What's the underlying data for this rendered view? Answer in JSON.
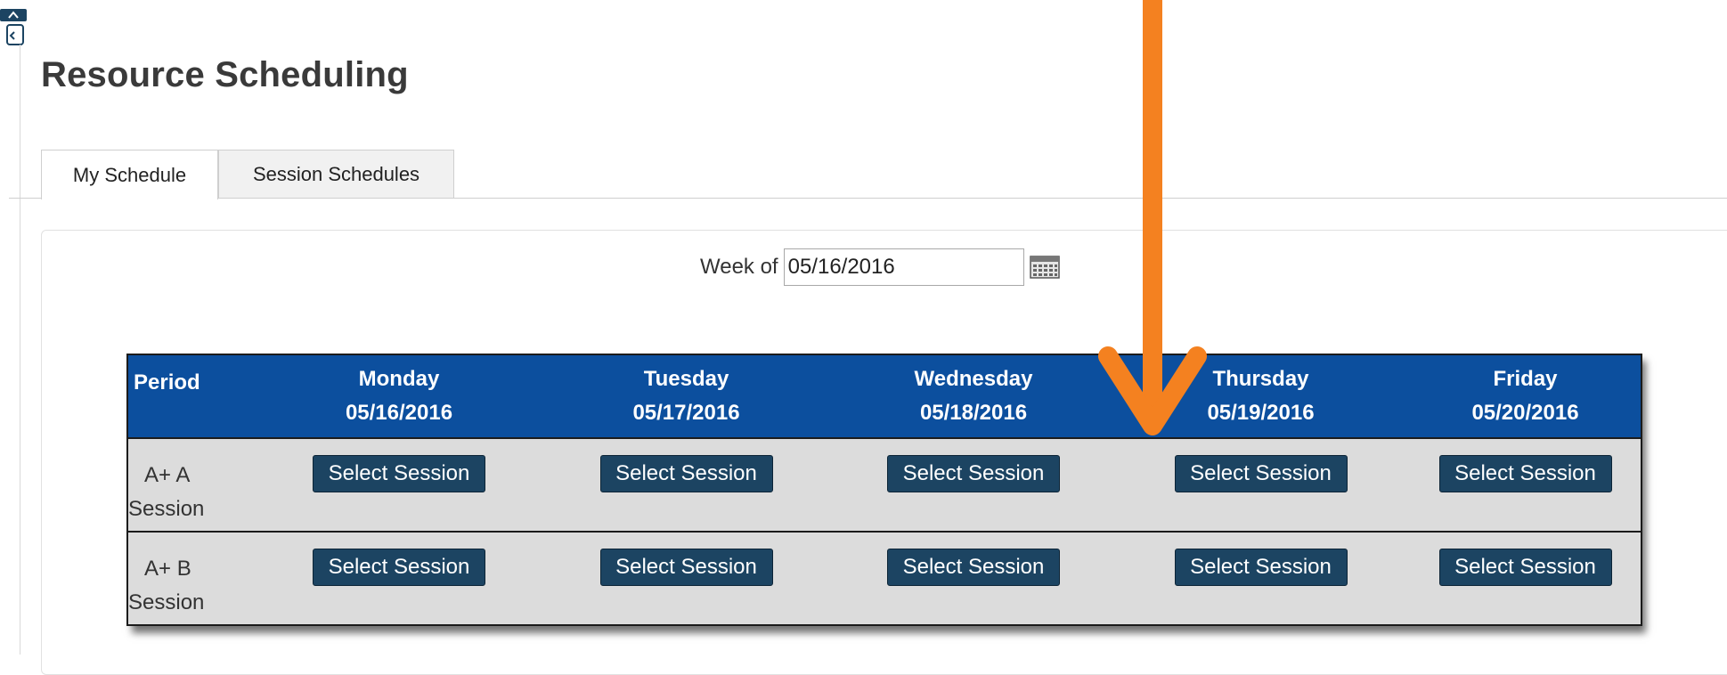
{
  "page": {
    "title": "Resource Scheduling"
  },
  "tabs": [
    {
      "label": "My Schedule",
      "active": true
    },
    {
      "label": "Session Schedules",
      "active": false
    }
  ],
  "week": {
    "label": "Week of",
    "value": "05/16/2016"
  },
  "schedule": {
    "period_header": "Period",
    "days": [
      {
        "name": "Monday",
        "date": "05/16/2016"
      },
      {
        "name": "Tuesday",
        "date": "05/17/2016"
      },
      {
        "name": "Wednesday",
        "date": "05/18/2016"
      },
      {
        "name": "Thursday",
        "date": "05/19/2016"
      },
      {
        "name": "Friday",
        "date": "05/20/2016"
      }
    ],
    "rows": [
      {
        "period_line1": "A+ A",
        "period_line2": "Session"
      },
      {
        "period_line1": "A+ B",
        "period_line2": "Session"
      }
    ],
    "button_label": "Select Session"
  },
  "colors": {
    "header_bg": "#0c4f9e",
    "button_bg": "#1c4462",
    "row_bg": "#dcdcdc",
    "annotation_arrow": "#f48120"
  },
  "icons": [
    "calendar-icon",
    "down-arrow-annotation-icon"
  ]
}
